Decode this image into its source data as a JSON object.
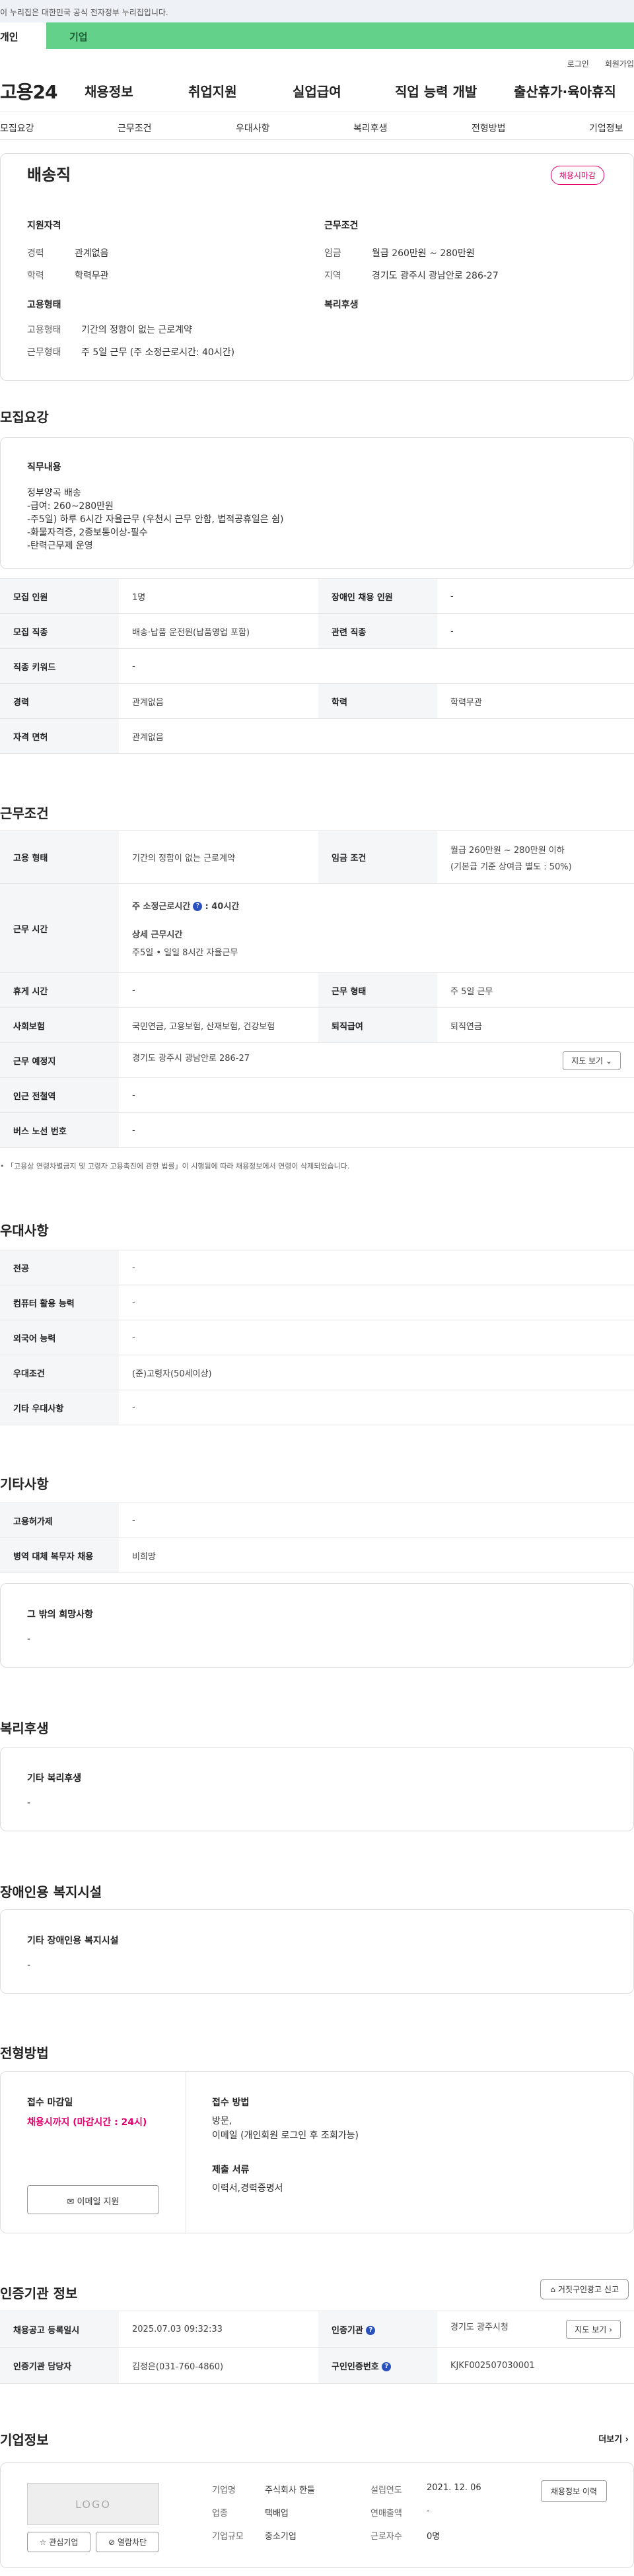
{
  "gov_banner": "이 누리집은 대한민국 공식 전자정부 누리집입니다.",
  "top_tabs": [
    "개인",
    "기업"
  ],
  "util": [
    "로그인",
    "회원가입"
  ],
  "gnb": {
    "logo": "고용24",
    "items": [
      "채용정보",
      "취업지원",
      "실업급여",
      "직업 능력 개발",
      "출산휴가·육아휴직"
    ]
  },
  "sub_tabs": [
    "모집요강",
    "근무조건",
    "우대사항",
    "복리후생",
    "전형방법",
    "기업정보"
  ],
  "summary": {
    "job_title": "배송직",
    "status_badge": "채용시마감",
    "qualification_title": "지원자격",
    "career_label": "경력",
    "career_value": "관계없음",
    "education_label": "학력",
    "education_value": "학력무관",
    "work_title": "근무조건",
    "wage_label": "임금",
    "wage_value": "월급 260만원 ~ 280만원",
    "region_label": "지역",
    "region_value": "경기도 광주시 광남안로 286-27",
    "employment_title": "고용형태",
    "emp_type_label": "고용형태",
    "emp_type_value": "기간의 정함이 없는 근로계약",
    "work_form_label": "근무형태",
    "work_form_value": "주 5일 근무 (주 소정근로시간: 40시간)",
    "welfare_title": "복리후생"
  },
  "recruit": {
    "title": "모집요강",
    "duty_title": "직무내용",
    "duty_lines": [
      "정부양곡 배송",
      "-급여: 260~280만원",
      "-주5일) 하루 6시간 자율근무 (우천시 근무 안함, 법적공휴일은 쉼)",
      "-화물자격증, 2종보통이상-필수",
      "-탄력근무제 운영"
    ],
    "rows": [
      {
        "k1": "모집 인원",
        "v1": "1명",
        "k2": "장애인 채용 인원",
        "v2": "-"
      },
      {
        "k1": "모집 직종",
        "v1": "배송·납품 운전원(납품영업 포함)",
        "k2": "관련 직종",
        "v2": "-"
      },
      {
        "k1": "직종 키워드",
        "v1": "-"
      },
      {
        "k1": "경력",
        "v1": "관계없음",
        "k2": "학력",
        "v2": "학력무관"
      },
      {
        "k1": "자격 면허",
        "v1": "관계없음"
      }
    ]
  },
  "condition": {
    "title": "근무조건",
    "emp_type_k": "고용 형태",
    "emp_type_v": "기간의 정함이 없는 근로계약",
    "wage_k": "임금 조건",
    "wage_v1": "월급 260만원 ~ 280만원 이하",
    "wage_v2": "(기본급 기준 상여금 별도 : 50%)",
    "hours_k": "근무 시간",
    "hours_t1": "주 소정근로시간",
    "hours_v1": ": 40시간",
    "hours_t2": "상세 근무시간",
    "hours_v2": "주5일 • 일일 8시간 자율근무",
    "rest_k": "휴게 시간",
    "rest_v": "-",
    "form_k": "근무 형태",
    "form_v": "주 5일 근무",
    "ins_k": "사회보험",
    "ins_v": "국민연금, 고용보험, 산재보험, 건강보험",
    "ret_k": "퇴직급여",
    "ret_v": "퇴직연금",
    "loc_k": "근무 예정지",
    "loc_v": "경기도 광주시 광남안로 286-27",
    "map_btn": "지도 보기",
    "subway_k": "인근 전철역",
    "subway_v": "-",
    "bus_k": "버스 노선 번호",
    "bus_v": "-",
    "note": "「고용상 연령차별금지 및 고령자 고용촉진에 관한 법률」이 시행됨에 따라 채용정보에서 연령이 삭제되었습니다."
  },
  "prefer": {
    "title": "우대사항",
    "rows": [
      {
        "k": "전공",
        "v": "-"
      },
      {
        "k": "컴퓨터 활용 능력",
        "v": "-"
      },
      {
        "k": "외국어 능력",
        "v": "-"
      },
      {
        "k": "우대조건",
        "v": "(준)고령자(50세이상)"
      },
      {
        "k": "기타 우대사항",
        "v": "-"
      }
    ]
  },
  "etc": {
    "title": "기타사항",
    "rows": [
      {
        "k": "고용허가제",
        "v": "-"
      },
      {
        "k": "병역 대체 복무자 채용",
        "v": "비희망"
      }
    ],
    "wish_title": "그 밖의 희망사항",
    "wish_v": "-"
  },
  "welfare": {
    "title": "복리후생",
    "sub": "기타 복리후생",
    "v": "-"
  },
  "disabled": {
    "title": "장애인용 복지시설",
    "sub": "기타 장애인용 복지시설",
    "v": "-"
  },
  "screening": {
    "title": "전형방법",
    "deadline_t": "접수 마감일",
    "deadline_v": "채용시까지 (마감시간 : 24시)",
    "method_t": "접수 방법",
    "method_v1": "방문,",
    "method_v2": "이메일 (개인회원 로그인 후 조회가능)",
    "docs_t": "제출 서류",
    "docs_v": "이력서,경력증명서",
    "email_btn": "이메일 지원"
  },
  "cert": {
    "title": "인증기관 정보",
    "report_btn": "거짓구인광고 신고",
    "reg_k": "채용공고 등록일시",
    "reg_v": "2025.07.03 09:32:33",
    "org_k": "인증기관",
    "org_v": "경기도 광주시청",
    "map_btn": "지도 보기",
    "mgr_k": "인증기관 담당자",
    "mgr_v": "김정은(031-760-4860)",
    "num_k": "구인인증번호",
    "num_v": "KJKF002507030001"
  },
  "company": {
    "title": "기업정보",
    "more": "더보기",
    "logo": "LOGO",
    "interest_btn": "관심기업",
    "block_btn": "열람차단",
    "name_k": "기업명",
    "name_v": "주식회사 한들",
    "found_k": "설립연도",
    "found_v": "2021. 12. 06",
    "ind_k": "업종",
    "ind_v": "택배업",
    "sales_k": "연매출액",
    "sales_v": "-",
    "size_k": "기업규모",
    "size_v": "중소기업",
    "emp_k": "근로자수",
    "emp_v": "0명",
    "history_btn": "채용정보 이력"
  }
}
